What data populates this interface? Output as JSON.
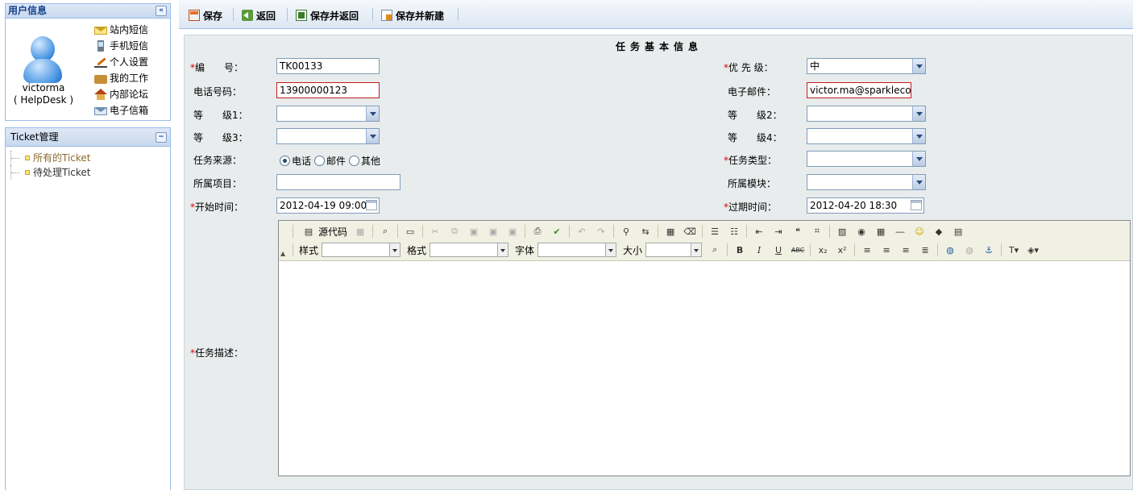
{
  "user_panel": {
    "title": "用户信息",
    "collapse_symbol": "«",
    "user_name": "victorma",
    "user_role": "( HelpDesk )",
    "links": [
      "站内短信",
      "手机短信",
      "个人设置",
      "我的工作",
      "内部论坛",
      "电子信箱"
    ]
  },
  "ticket_panel": {
    "title": "Ticket管理",
    "collapse_symbol": "−",
    "items": [
      "所有的Ticket",
      "待处理Ticket"
    ]
  },
  "toolbar": {
    "save": "保存",
    "back": "返回",
    "save_back": "保存并返回",
    "save_new": "保存并新建"
  },
  "form": {
    "title": "任务基本信息",
    "required_mark": "*",
    "number_label": "编　　号：",
    "number_value": "TK00133",
    "priority_label": "优 先 级：",
    "priority_value": "中",
    "phone_label": "电话号码：",
    "phone_value": "13900000123",
    "email_label": "电子邮件：",
    "email_value": "victor.ma@sparklecom",
    "level1_label": "等　　级1：",
    "level2_label": "等　　级2：",
    "level3_label": "等　　级3：",
    "level4_label": "等　　级4：",
    "source_label": "任务来源：",
    "source_options": [
      "电话",
      "邮件",
      "其他"
    ],
    "task_type_label": "任务类型：",
    "project_label": "所属项目：",
    "module_label": "所属模块：",
    "start_label": "开始时间：",
    "start_value": "2012-04-19 09:00",
    "due_label": "过期时间：",
    "due_value": "2012-04-20 18:30",
    "desc_label": "任务描述："
  },
  "editor": {
    "source_label": "源代码",
    "style_label": "样式",
    "format_label": "格式",
    "font_label": "字体",
    "size_label": "大小"
  }
}
